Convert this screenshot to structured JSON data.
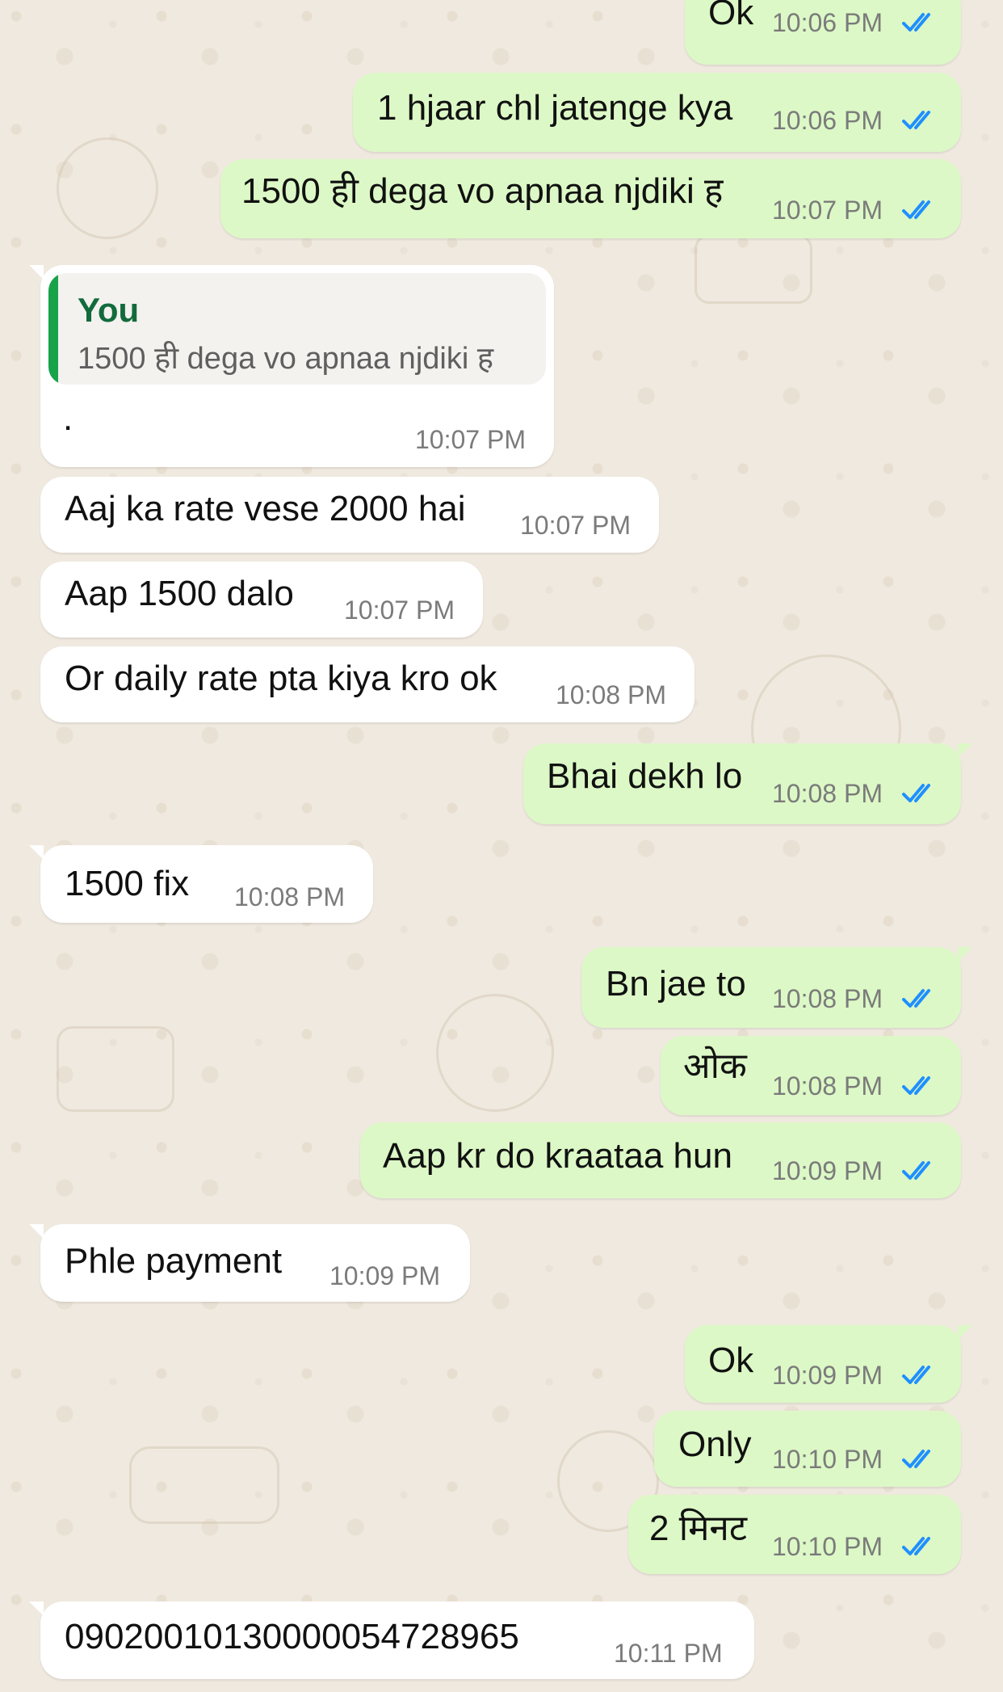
{
  "chat": {
    "messages": [
      {
        "direction": "out",
        "text": "Ok",
        "time": "10:06 PM",
        "status": "read"
      },
      {
        "direction": "out",
        "text": "1 hjaar chl jatenge kya",
        "time": "10:06 PM",
        "status": "read"
      },
      {
        "direction": "out",
        "text": "1500 ही dega vo apnaa njdiki ह",
        "time": "10:07 PM",
        "status": "read"
      },
      {
        "direction": "in",
        "quoted_author": "You",
        "quoted_text": "1500 ही dega vo apnaa njdiki ह",
        "text": ".",
        "time": "10:07 PM"
      },
      {
        "direction": "in",
        "text": "Aaj ka rate vese 2000 hai",
        "time": "10:07 PM"
      },
      {
        "direction": "in",
        "text": "Aap 1500 dalo",
        "time": "10:07 PM"
      },
      {
        "direction": "in",
        "text": "Or daily rate pta kiya kro ok",
        "time": "10:08 PM"
      },
      {
        "direction": "out",
        "text": "Bhai dekh lo",
        "time": "10:08 PM",
        "status": "read"
      },
      {
        "direction": "in",
        "text": "1500 fix",
        "time": "10:08 PM"
      },
      {
        "direction": "out",
        "text": "Bn jae to",
        "time": "10:08 PM",
        "status": "read"
      },
      {
        "direction": "out",
        "text": "ओक",
        "time": "10:08 PM",
        "status": "read"
      },
      {
        "direction": "out",
        "text": "Aap kr do kraataa hun",
        "time": "10:09 PM",
        "status": "read"
      },
      {
        "direction": "in",
        "text": "Phle payment",
        "time": "10:09 PM"
      },
      {
        "direction": "out",
        "text": "Ok",
        "time": "10:09 PM",
        "status": "read"
      },
      {
        "direction": "out",
        "text": "Only",
        "time": "10:10 PM",
        "status": "read"
      },
      {
        "direction": "out",
        "text": "2 मिनट",
        "time": "10:10 PM",
        "status": "read"
      },
      {
        "direction": "in",
        "text": "09020010130000054728965",
        "time": "10:11 PM"
      }
    ]
  },
  "colors": {
    "background": "#efe9df",
    "outgoing_bubble": "#dcf8c6",
    "incoming_bubble": "#ffffff",
    "read_ticks": "#1f8fff",
    "quote_accent": "#18a34a",
    "quote_author": "#136b3c"
  },
  "icons": {
    "read_receipt": "double-check-icon"
  }
}
